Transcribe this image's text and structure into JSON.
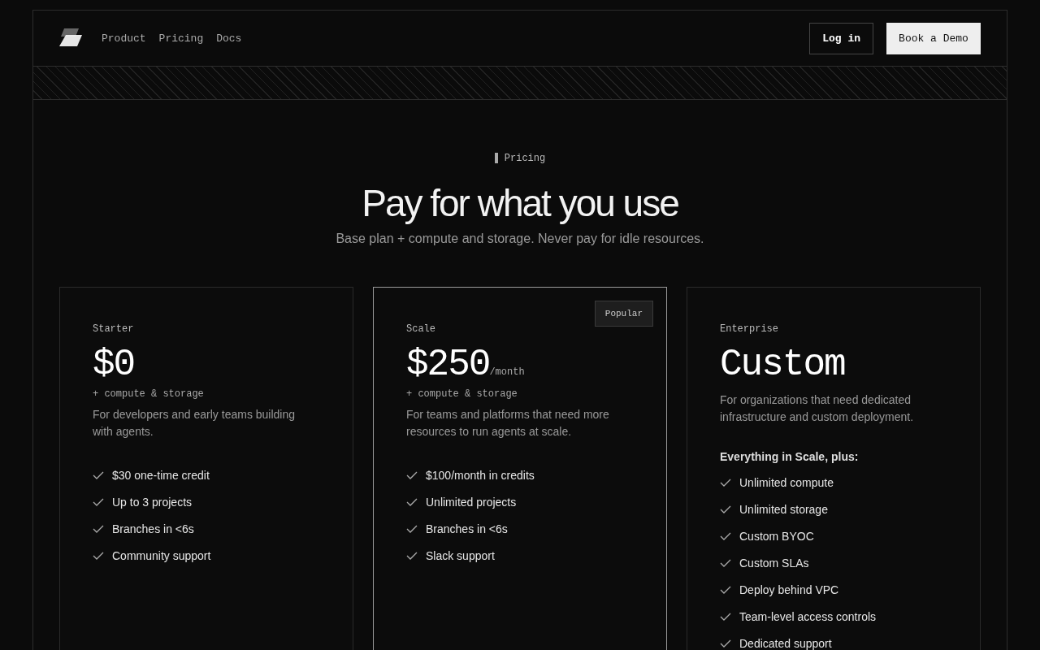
{
  "nav": {
    "links": [
      "Product",
      "Pricing",
      "Docs"
    ],
    "login": "Log in",
    "demo": "Book a Demo"
  },
  "hero": {
    "eyebrow": "Pricing",
    "title": "Pay for what you use",
    "subtitle": "Base plan + compute and storage. Never pay for idle resources."
  },
  "plans": [
    {
      "name": "Starter",
      "price": "$0",
      "note": "+ compute & storage",
      "description": "For developers and early teams building with agents.",
      "featured": false,
      "features": [
        "$30 one-time credit",
        "Up to 3 projects",
        "Branches in <6s",
        "Community support"
      ]
    },
    {
      "name": "Scale",
      "price": "$250",
      "period": "/month",
      "note": "+ compute & storage",
      "description": "For teams and platforms that need more resources to run agents at scale.",
      "featured": true,
      "badge": "Popular",
      "features": [
        "$100/month in credits",
        "Unlimited projects",
        "Branches in <6s",
        "Slack support"
      ]
    },
    {
      "name": "Enterprise",
      "price": "Custom",
      "description": "For organizations that need dedicated infrastructure and custom deployment.",
      "featured": false,
      "features_heading": "Everything in Scale, plus:",
      "features": [
        "Unlimited compute",
        "Unlimited storage",
        "Custom BYOC",
        "Custom SLAs",
        "Deploy behind VPC",
        "Team-level access controls",
        "Dedicated support"
      ]
    }
  ]
}
